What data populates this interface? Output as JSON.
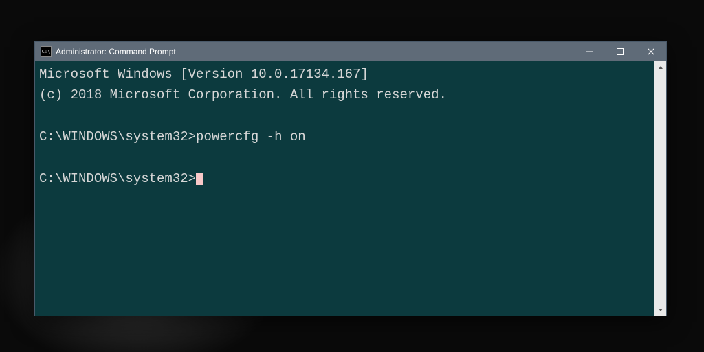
{
  "window": {
    "title": "Administrator: Command Prompt",
    "icon_label": "C:\\"
  },
  "terminal": {
    "line1": "Microsoft Windows [Version 10.0.17134.167]",
    "line2": "(c) 2018 Microsoft Corporation. All rights reserved.",
    "blank1": "",
    "prompt1": "C:\\WINDOWS\\system32>",
    "command1": "powercfg -h on",
    "blank2": "",
    "prompt2": "C:\\WINDOWS\\system32>"
  }
}
